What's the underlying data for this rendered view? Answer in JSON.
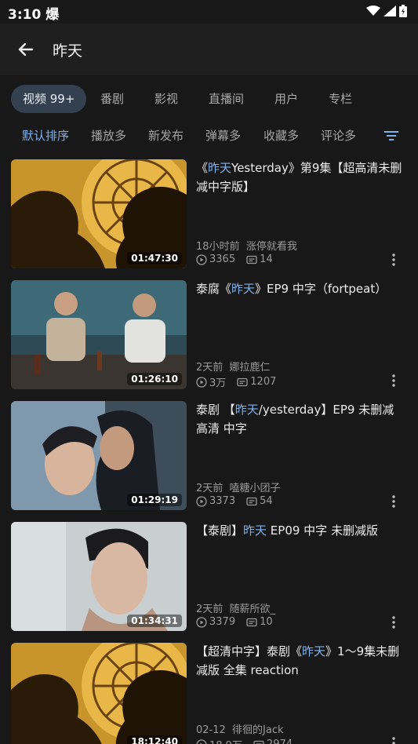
{
  "status_bar": {
    "time": "3:10",
    "extra_glyph": "爆"
  },
  "header": {
    "query": "昨天"
  },
  "category_tabs": [
    {
      "label": "视频 99+",
      "active": true
    },
    {
      "label": "番剧",
      "active": false
    },
    {
      "label": "影视",
      "active": false
    },
    {
      "label": "直播间",
      "active": false
    },
    {
      "label": "用户",
      "active": false
    },
    {
      "label": "专栏",
      "active": false
    }
  ],
  "sort_options": [
    {
      "label": "默认排序",
      "active": true
    },
    {
      "label": "播放多",
      "active": false
    },
    {
      "label": "新发布",
      "active": false
    },
    {
      "label": "弹幕多",
      "active": false
    },
    {
      "label": "收藏多",
      "active": false
    },
    {
      "label": "评论多",
      "active": false
    }
  ],
  "colors": {
    "accent": "#7fb0ea",
    "background": "#181818"
  },
  "videos": [
    {
      "title_parts": [
        [
          "《",
          false
        ],
        [
          "昨天",
          true
        ],
        [
          "Yesterday》第9集【超高清未删减中字版】",
          false
        ]
      ],
      "duration": "01:47:30",
      "time": "18小时前",
      "uploader": "涨停就看我",
      "plays": "3365",
      "danmaku": "14",
      "thumb_style": "warm-window"
    },
    {
      "title_parts": [
        [
          "泰腐《",
          false
        ],
        [
          "昨天",
          true
        ],
        [
          "》EP9 中字（fortpeat）",
          false
        ]
      ],
      "duration": "01:26:10",
      "time": "2天前",
      "uploader": "娜拉鹿仁",
      "plays": "3万",
      "danmaku": "1207",
      "thumb_style": "teal-room"
    },
    {
      "title_parts": [
        [
          "泰剧 【",
          false
        ],
        [
          "昨天",
          true
        ],
        [
          "/yesterday】EP9  未删减 高清 中字",
          false
        ]
      ],
      "duration": "01:29:19",
      "time": "2天前",
      "uploader": "嗑糖小团子",
      "plays": "3373",
      "danmaku": "54",
      "thumb_style": "cool-closeup"
    },
    {
      "title_parts": [
        [
          "【泰剧】",
          false
        ],
        [
          "昨天",
          true
        ],
        [
          " EP09  中字 未删减版",
          false
        ]
      ],
      "duration": "01:34:31",
      "time": "2天前",
      "uploader": "随薪所欲_",
      "plays": "3379",
      "danmaku": "10",
      "thumb_style": "portrait"
    },
    {
      "title_parts": [
        [
          "【超清中字】泰剧《",
          false
        ],
        [
          "昨天",
          true
        ],
        [
          "》1～9集未删减版 全集 reaction",
          false
        ]
      ],
      "duration": "18:12:40",
      "time": "02-12",
      "uploader": "徘徊的Jack",
      "plays": "18.9万",
      "danmaku": "2974",
      "thumb_style": "warm-window"
    }
  ]
}
